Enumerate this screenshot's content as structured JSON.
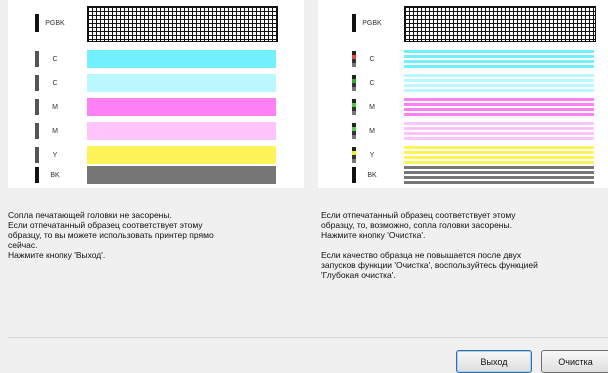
{
  "panels": {
    "left": {
      "labels": [
        "PGBK",
        "C",
        "C",
        "M",
        "M",
        "Y",
        "BK"
      ],
      "description": [
        "Сопла печатающей головки не засорены.",
        "Если отпечатанный образец соответствует этому",
        "образцу, то вы можете использовать принтер прямо",
        "сейчас.",
        "Нажмите кнопку 'Выход'."
      ]
    },
    "right": {
      "labels": [
        "PGBK",
        "C",
        "C",
        "M",
        "M",
        "Y",
        "BK"
      ],
      "description_p1": [
        "Если отпечатанный образец соответствует этому",
        "образцу, то, возможно, сопла головки засорены.",
        "Нажмите кнопку 'Очистка'."
      ],
      "description_p2": [
        "Если качество образца не повышается после двух",
        "запусков функции 'Очистка', воспользуйтесь функцией",
        "'Глубокая очистка'."
      ]
    }
  },
  "buttons": {
    "exit_label": "Выход",
    "clean_label": "Очистка"
  },
  "colors": {
    "cyan": "#72f0ff",
    "magenta": "#ff80f4",
    "yellow": "#fff35a",
    "black": "#777777"
  }
}
